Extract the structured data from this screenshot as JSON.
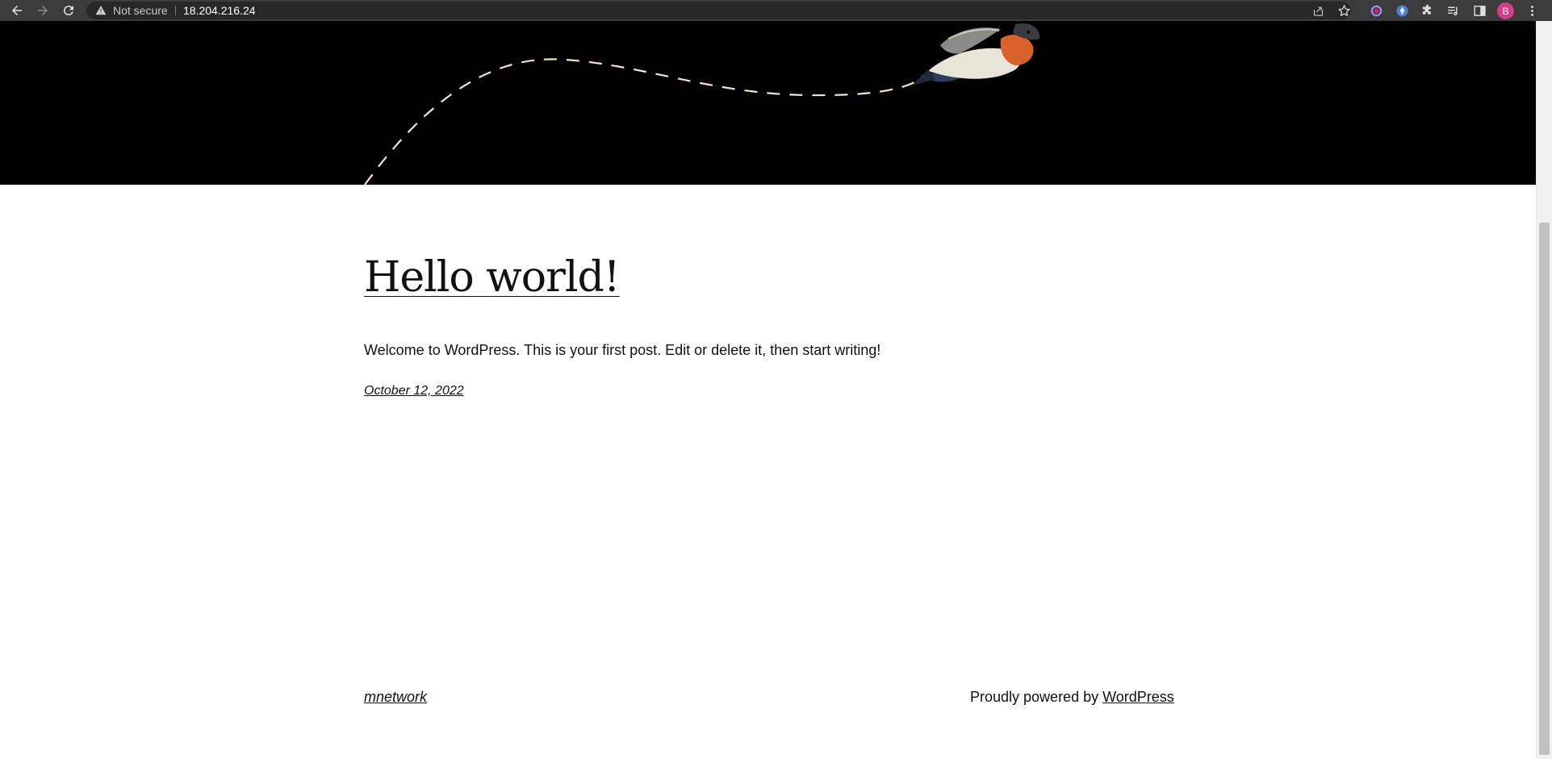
{
  "browser": {
    "security_label": "Not secure",
    "url": "18.204.216.24",
    "profile_initial": "B",
    "icons": [
      "back-icon",
      "forward-icon",
      "reload-icon",
      "warning-icon",
      "share-icon",
      "bookmark-star-icon",
      "extension-icon",
      "extensions-puzzle-icon",
      "reading-list-icon",
      "side-panel-icon",
      "menu-icon"
    ],
    "accent_color": "#d23f8a"
  },
  "hero": {
    "background": "#000000",
    "path_color": "#f2e6c9",
    "image": "bird-illustration"
  },
  "post": {
    "title": "Hello world!",
    "excerpt": "Welcome to WordPress. This is your first post. Edit or delete it, then start writing!",
    "date": "October 12, 2022"
  },
  "footer": {
    "site_name": "mnetwork",
    "credit_prefix": "Proudly powered by ",
    "credit_link": "WordPress"
  }
}
